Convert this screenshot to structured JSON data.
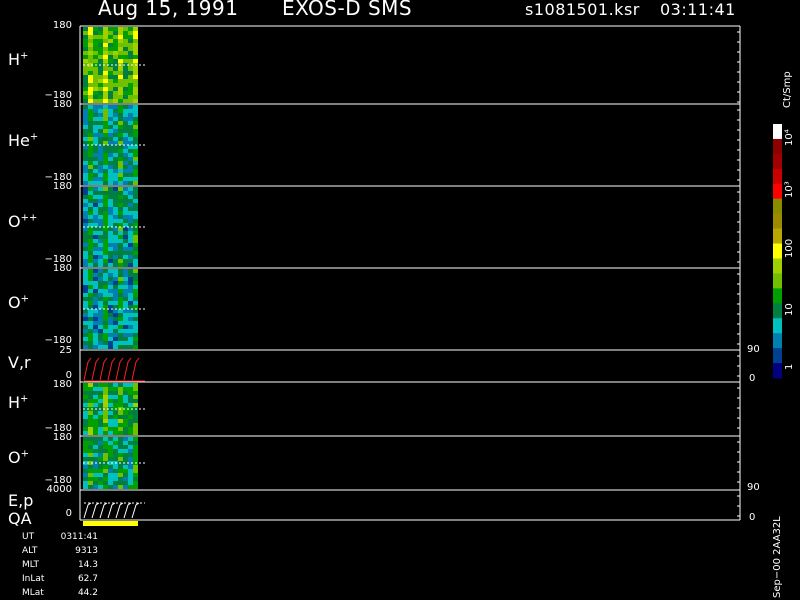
{
  "header": {
    "date": "Aug 15, 1991",
    "instrument": "EXOS-D SMS",
    "file": "s1081501.ksr",
    "time": "03:11:41"
  },
  "panels": [
    {
      "id": "h-plus",
      "label": "H",
      "sup": "+",
      "top_tick": "180",
      "bottom_tick": "−180"
    },
    {
      "id": "he-plus",
      "label": "He",
      "sup": "+",
      "top_tick": "180",
      "bottom_tick": "−180"
    },
    {
      "id": "o-plusplus",
      "label": "O",
      "sup": "++",
      "top_tick": "180",
      "bottom_tick": "−180"
    },
    {
      "id": "o-plus",
      "label": "O",
      "sup": "+",
      "top_tick": "180",
      "bottom_tick": "−180"
    },
    {
      "id": "vr",
      "label": "V,r",
      "sup": "",
      "top_tick": "25",
      "bottom_tick": "0",
      "right_top": "90",
      "right_bottom": "0"
    },
    {
      "id": "h-plus-2",
      "label": "H",
      "sup": "+",
      "top_tick": "180",
      "bottom_tick": "−180"
    },
    {
      "id": "o-plus-2",
      "label": "O",
      "sup": "+",
      "top_tick": "180",
      "bottom_tick": "−180"
    },
    {
      "id": "ep",
      "label": "E,p",
      "sup": "",
      "label2": "QA",
      "top_tick": "4000",
      "bottom_tick": "0",
      "right_top": "90",
      "right_bottom": "0"
    }
  ],
  "colorbar": {
    "title": "Ct/Smp",
    "labels": [
      "10⁴",
      "10³",
      "100",
      "10",
      "1"
    ],
    "colors": [
      "#ffffff",
      "#8b0000",
      "#a00000",
      "#c80000",
      "#ff0000",
      "#8b8b00",
      "#9b8b00",
      "#b8a800",
      "#ffff00",
      "#a0d000",
      "#70c000",
      "#00a000",
      "#008040",
      "#00c0c0",
      "#0080b0",
      "#004090",
      "#000080"
    ]
  },
  "info": [
    {
      "key": "UT",
      "value": "0311:41"
    },
    {
      "key": "ALT",
      "value": "9313"
    },
    {
      "key": "MLT",
      "value": "14.3"
    },
    {
      "key": "InLat",
      "value": "62.7"
    },
    {
      "key": "MLat",
      "value": "44.2"
    }
  ],
  "footer_right": "Sep−00  2AA32L",
  "chart_data": {
    "type": "heatmap",
    "title": "Aug 15, 1991   EXOS-D SMS",
    "panels": [
      "H+",
      "He+",
      "O++",
      "O+",
      "V,r",
      "H+",
      "O+",
      "E,p QA"
    ],
    "ylim_pitch": [
      -180,
      180
    ],
    "vr_ylim": [
      0,
      25
    ],
    "ep_ylim": [
      0,
      4000
    ],
    "colorscale_counts": [
      1,
      10,
      100,
      1000,
      10000
    ]
  }
}
